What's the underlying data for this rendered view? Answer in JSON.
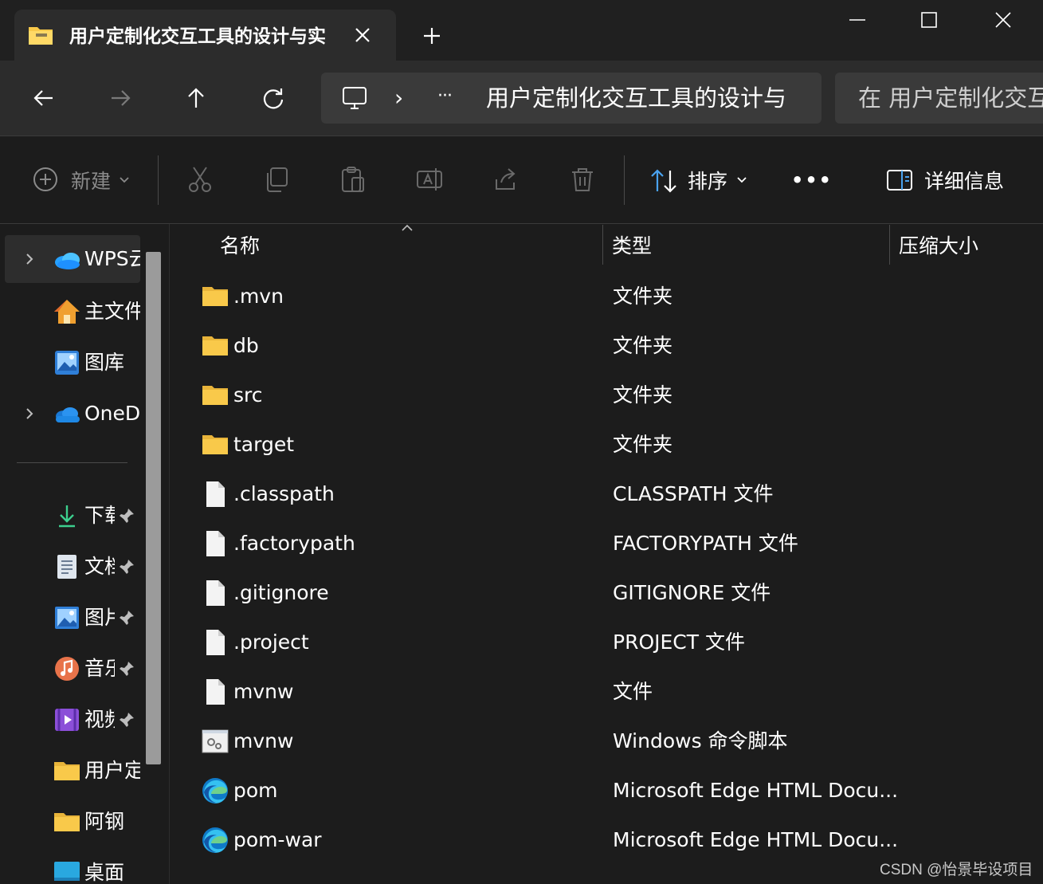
{
  "window": {
    "tab_title": "用户定制化交互工具的设计与实",
    "new_tab_icon": "plus-icon",
    "controls": [
      "minimize-icon",
      "maximize-icon",
      "close-icon"
    ]
  },
  "nav": {
    "address_separator": "›",
    "address_overflow": "···",
    "address_text": "用户定制化交互工具的设计与",
    "search_placeholder": "在 用户定制化交互"
  },
  "toolbar": {
    "new_label": "新建",
    "sort_label": "排序",
    "more_label": "•••",
    "details_label": "详细信息"
  },
  "sidebar": {
    "items": [
      {
        "label": "WPS云",
        "icon": "wps-cloud-icon",
        "expandable": true
      },
      {
        "label": "主文件",
        "icon": "home-icon",
        "expandable": false
      },
      {
        "label": "图库",
        "icon": "gallery-icon",
        "expandable": false
      },
      {
        "label": "OneD",
        "icon": "onedrive-icon",
        "expandable": true
      }
    ],
    "pinned": [
      {
        "label": "下载",
        "icon": "download-icon"
      },
      {
        "label": "文档",
        "icon": "documents-icon"
      },
      {
        "label": "图片",
        "icon": "pictures-icon"
      },
      {
        "label": "音乐",
        "icon": "music-icon"
      },
      {
        "label": "视频",
        "icon": "videos-icon"
      },
      {
        "label": "用户定",
        "icon": "folder-icon"
      },
      {
        "label": "阿钢",
        "icon": "folder-icon"
      },
      {
        "label": "桌面",
        "icon": "desktop-icon"
      }
    ]
  },
  "columns": {
    "name": "名称",
    "type": "类型",
    "size": "压缩大小"
  },
  "files": [
    {
      "name": ".mvn",
      "type": "文件夹",
      "icon": "folder"
    },
    {
      "name": "db",
      "type": "文件夹",
      "icon": "folder"
    },
    {
      "name": "src",
      "type": "文件夹",
      "icon": "folder"
    },
    {
      "name": "target",
      "type": "文件夹",
      "icon": "folder"
    },
    {
      "name": ".classpath",
      "type": "CLASSPATH 文件",
      "icon": "file"
    },
    {
      "name": ".factorypath",
      "type": "FACTORYPATH 文件",
      "icon": "file"
    },
    {
      "name": ".gitignore",
      "type": "GITIGNORE 文件",
      "icon": "file"
    },
    {
      "name": ".project",
      "type": "PROJECT 文件",
      "icon": "file"
    },
    {
      "name": "mvnw",
      "type": "文件",
      "icon": "file"
    },
    {
      "name": "mvnw",
      "type": "Windows 命令脚本",
      "icon": "script"
    },
    {
      "name": "pom",
      "type": "Microsoft Edge HTML Docu...",
      "icon": "edge"
    },
    {
      "name": "pom-war",
      "type": "Microsoft Edge HTML Docu...",
      "icon": "edge"
    }
  ],
  "watermark": "CSDN @怡景毕设项目",
  "colors": {
    "background": "#1c1c1c",
    "folder": "#f9c94a",
    "accent": "#4aa3f0"
  }
}
